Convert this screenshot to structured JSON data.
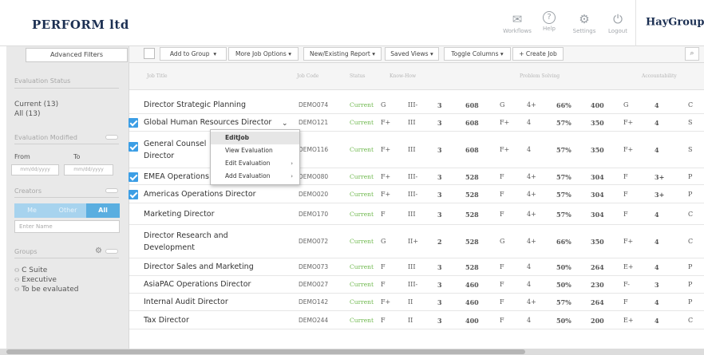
{
  "header": {
    "brand": "PERFORM ltd",
    "icons": [
      {
        "name": "workflows-icon",
        "glyph": "✉",
        "label": "Workflows"
      },
      {
        "name": "help-icon",
        "glyph": "?",
        "label": "Help"
      },
      {
        "name": "settings-icon",
        "glyph": "⚙",
        "label": "Settings"
      },
      {
        "name": "logout-icon",
        "glyph": "⏻",
        "label": "Logout"
      }
    ],
    "logo": "HayGroup",
    "logo_mark": "®"
  },
  "sidebar": {
    "advanced_filters": "Advanced Filters",
    "evaluation_status_label": "Evaluation Status",
    "status_current": "Current (13)",
    "status_all": "All (13)",
    "evaluation_modified_label": "Evaluation Modified",
    "from_label": "From",
    "to_label": "To",
    "from_placeholder": "mm/dd/yyyy",
    "to_placeholder": "mm/dd/yyyy",
    "creators_label": "Creators",
    "creator_options": [
      "Me",
      "Other",
      "All"
    ],
    "creator_selected": "All",
    "enter_name_placeholder": "Enter Name",
    "groups_label": "Groups",
    "groups": [
      "C Suite",
      "Executive",
      "To be evaluated"
    ]
  },
  "toolbar": {
    "add_to_group": "Add to Group",
    "more_job_options": "More Job Options",
    "new_existing_report": "New/Existing Report",
    "saved_views": "Saved Views",
    "toggle_columns": "Toggle Columns",
    "create_job": "+ Create Job",
    "search_icon": "search-icon"
  },
  "table": {
    "headers": {
      "job_title": "Job Title",
      "job_code": "Job Code",
      "status": "Status",
      "know_how": "Know-How",
      "problem_solving": "Problem Solving",
      "accountability": "Accountability"
    },
    "rows": [
      {
        "title": [
          "Director Strategic Planning"
        ],
        "code": "DEMO074",
        "status": "Current",
        "kh1": "G",
        "kh2": "III-",
        "kh3": "3",
        "kh": "608",
        "ps1": "G",
        "ps2": "4+",
        "ps": "66%",
        "psv": "400",
        "ac1": "G",
        "ac2": "4",
        "ac3": "C",
        "checked": false
      },
      {
        "title": [
          "Global Human Resources Director"
        ],
        "code": "DEMO121",
        "status": "Current",
        "kh1": "F+",
        "kh2": "III",
        "kh3": "3",
        "kh": "608",
        "ps1": "F+",
        "ps2": "4",
        "ps": "57%",
        "psv": "350",
        "ac1": "F+",
        "ac2": "4",
        "ac3": "S",
        "checked": true
      },
      {
        "title": [
          "General Counsel",
          "Director"
        ],
        "code": "DEMO116",
        "status": "Current",
        "kh1": "F+",
        "kh2": "III",
        "kh3": "3",
        "kh": "608",
        "ps1": "F+",
        "ps2": "4",
        "ps": "57%",
        "psv": "350",
        "ac1": "F+",
        "ac2": "4",
        "ac3": "S",
        "checked": true
      },
      {
        "title": [
          "EMEA Operations"
        ],
        "code": "DEMO080",
        "status": "Current",
        "kh1": "F+",
        "kh2": "III-",
        "kh3": "3",
        "kh": "528",
        "ps1": "F",
        "ps2": "4+",
        "ps": "57%",
        "psv": "304",
        "ac1": "F",
        "ac2": "3+",
        "ac3": "P",
        "checked": true
      },
      {
        "title": [
          "Americas Operations Director"
        ],
        "code": "DEMO020",
        "status": "Current",
        "kh1": "F+",
        "kh2": "III-",
        "kh3": "3",
        "kh": "528",
        "ps1": "F",
        "ps2": "4+",
        "ps": "57%",
        "psv": "304",
        "ac1": "F",
        "ac2": "3+",
        "ac3": "P",
        "checked": true
      },
      {
        "title": [
          "Marketing Director"
        ],
        "code": "DEMO170",
        "status": "Current",
        "kh1": "F",
        "kh2": "III",
        "kh3": "3",
        "kh": "528",
        "ps1": "F",
        "ps2": "4+",
        "ps": "57%",
        "psv": "304",
        "ac1": "F",
        "ac2": "4",
        "ac3": "C",
        "checked": false
      },
      {
        "title": [
          "Director Research and",
          "Development"
        ],
        "code": "DEMO072",
        "status": "Current",
        "kh1": "G",
        "kh2": "II+",
        "kh3": "2",
        "kh": "528",
        "ps1": "G",
        "ps2": "4+",
        "ps": "66%",
        "psv": "350",
        "ac1": "F+",
        "ac2": "4",
        "ac3": "C",
        "checked": false
      },
      {
        "title": [
          "Director Sales and Marketing"
        ],
        "code": "DEMO073",
        "status": "Current",
        "kh1": "F",
        "kh2": "III",
        "kh3": "3",
        "kh": "528",
        "ps1": "F",
        "ps2": "4",
        "ps": "50%",
        "psv": "264",
        "ac1": "E+",
        "ac2": "4",
        "ac3": "P",
        "checked": false
      },
      {
        "title": [
          "AsiaPAC Operations Director"
        ],
        "code": "DEMO027",
        "status": "Current",
        "kh1": "F",
        "kh2": "III-",
        "kh3": "3",
        "kh": "460",
        "ps1": "F",
        "ps2": "4",
        "ps": "50%",
        "psv": "230",
        "ac1": "F-",
        "ac2": "3",
        "ac3": "P",
        "checked": false
      },
      {
        "title": [
          "Internal Audit Director"
        ],
        "code": "DEMO142",
        "status": "Current",
        "kh1": "F+",
        "kh2": "II",
        "kh3": "3",
        "kh": "460",
        "ps1": "F",
        "ps2": "4+",
        "ps": "57%",
        "psv": "264",
        "ac1": "F",
        "ac2": "4",
        "ac3": "P",
        "checked": false
      },
      {
        "title": [
          "Tax Director"
        ],
        "code": "DEMO244",
        "status": "Current",
        "kh1": "F",
        "kh2": "II",
        "kh3": "3",
        "kh": "400",
        "ps1": "F",
        "ps2": "4",
        "ps": "50%",
        "psv": "200",
        "ac1": "E+",
        "ac2": "4",
        "ac3": "C",
        "checked": false
      }
    ]
  },
  "context_menu": {
    "items": [
      {
        "label": "EditJob",
        "highlighted": true,
        "submenu": false
      },
      {
        "label": "View Evaluation",
        "highlighted": false,
        "submenu": false
      },
      {
        "label": "Edit Evaluation",
        "highlighted": false,
        "submenu": true
      },
      {
        "label": "Add Evaluation",
        "highlighted": false,
        "submenu": true
      }
    ]
  },
  "colors": {
    "brand": "#1b2f52",
    "status_current": "#6eb84d",
    "check_blue": "#3c9ee5",
    "creator_selected": "#5aaee0"
  }
}
